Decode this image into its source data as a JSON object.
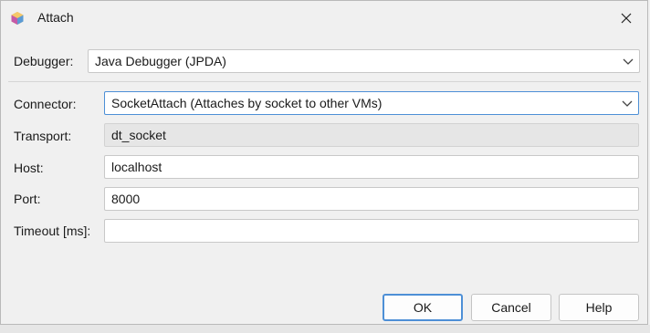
{
  "window": {
    "title": "Attach",
    "close_icon": "close-icon",
    "app_icon": "netbeans-cube-icon"
  },
  "form": {
    "debugger": {
      "label": "Debugger:",
      "value": "Java Debugger (JPDA)"
    },
    "connector": {
      "label": "Connector:",
      "value": "SocketAttach (Attaches by socket to other VMs)"
    },
    "transport": {
      "label": "Transport:",
      "value": "dt_socket"
    },
    "host": {
      "label": "Host:",
      "value": "localhost"
    },
    "port": {
      "label": "Port:",
      "value": "8000"
    },
    "timeout": {
      "label": "Timeout [ms]:",
      "value": ""
    }
  },
  "buttons": {
    "ok": "OK",
    "cancel": "Cancel",
    "help": "Help"
  },
  "colors": {
    "accent": "#4d8fd6",
    "dialog_bg": "#f0f0f0",
    "readonly_bg": "#e6e6e6"
  }
}
